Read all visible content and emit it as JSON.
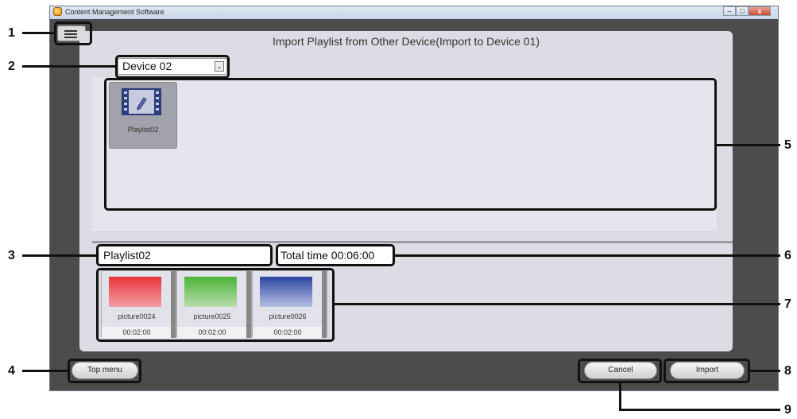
{
  "window": {
    "title": "Content Management Software",
    "controls": {
      "minimize": "–",
      "maximize": "□",
      "close": "x"
    }
  },
  "dialog": {
    "title": "Import Playlist from Other Device(Import to Device 01)",
    "device_select": {
      "value": "Device 02",
      "arrow": "⌄"
    },
    "playlists": [
      {
        "name": "Playlist02",
        "icon": "film-edit-icon"
      }
    ],
    "selected_playlist_name": "Playlist02",
    "total_time": "Total time 00:06:00",
    "contents": [
      {
        "name": "picture0024",
        "duration": "00:02:00",
        "color_top": "#e8323a",
        "color_bottom": "#f4a0a6"
      },
      {
        "name": "picture0025",
        "duration": "00:02:00",
        "color_top": "#4cb43a",
        "color_bottom": "#b8dcac"
      },
      {
        "name": "picture0026",
        "duration": "00:02:00",
        "color_top": "#2d45a0",
        "color_bottom": "#b6c0e4"
      }
    ]
  },
  "buttons": {
    "top_menu": "Top menu",
    "cancel": "Cancel",
    "import": "Import"
  },
  "callouts": [
    "1",
    "2",
    "3",
    "4",
    "5",
    "6",
    "7",
    "8",
    "9"
  ]
}
